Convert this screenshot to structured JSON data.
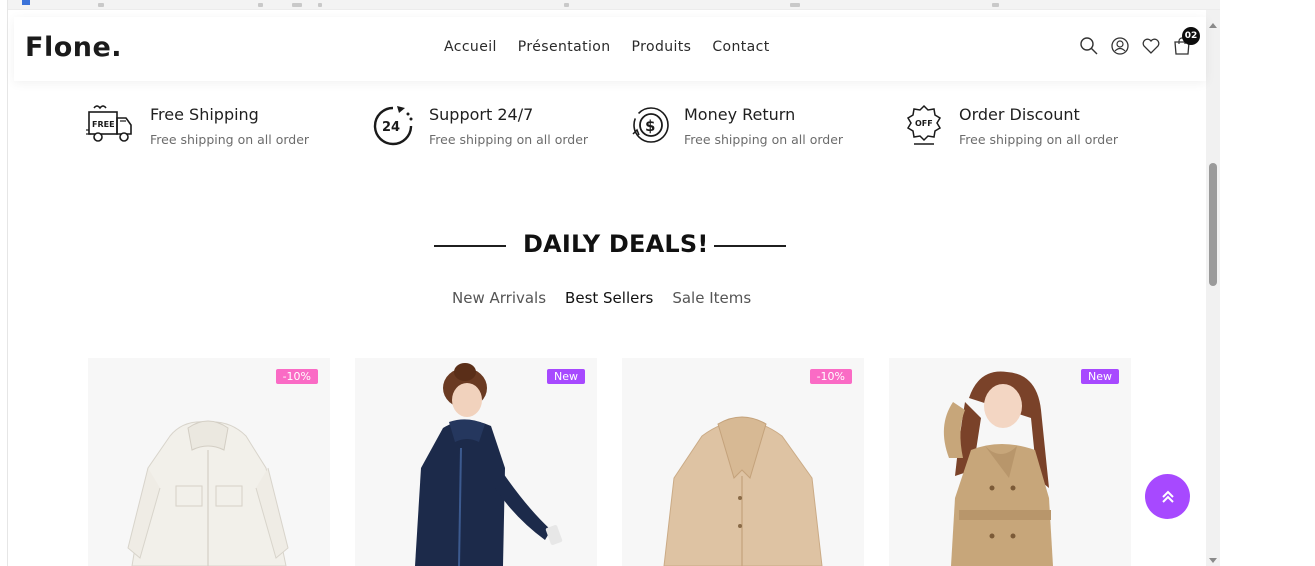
{
  "header": {
    "logo": "Flone.",
    "nav": [
      "Accueil",
      "Présentation",
      "Produits",
      "Contact"
    ],
    "icons": [
      "search-icon",
      "account-icon",
      "wishlist-icon",
      "cart-icon"
    ],
    "cart_count": "02"
  },
  "features": [
    {
      "icon": "free-shipping-truck-icon",
      "title": "Free Shipping",
      "desc": "Free shipping on all order"
    },
    {
      "icon": "support-24-icon",
      "title": "Support 24/7",
      "desc": "Free shipping on all order"
    },
    {
      "icon": "money-return-icon",
      "title": "Money Return",
      "desc": "Free shipping on all order"
    },
    {
      "icon": "order-discount-icon",
      "title": "Order Discount",
      "desc": "Free shipping on all order"
    }
  ],
  "section": {
    "title": "DAILY DEALS!",
    "tabs": [
      "New Arrivals",
      "Best Sellers",
      "Sale Items"
    ],
    "active_tab": "Best Sellers"
  },
  "products": [
    {
      "badge": "-10%",
      "badge_type": "discount",
      "image": "white jacket"
    },
    {
      "badge": "New",
      "badge_type": "new",
      "image": "woman in navy hooded coat"
    },
    {
      "badge": "-10%",
      "badge_type": "discount",
      "image": "beige teddy coat"
    },
    {
      "badge": "New",
      "badge_type": "new",
      "image": "woman in beige trench coat"
    }
  ],
  "colors": {
    "accent": "#a749ff",
    "discount_badge": "#fa6bc5",
    "new_badge": "#a749ff",
    "cart_badge": "#0d0d0d"
  }
}
